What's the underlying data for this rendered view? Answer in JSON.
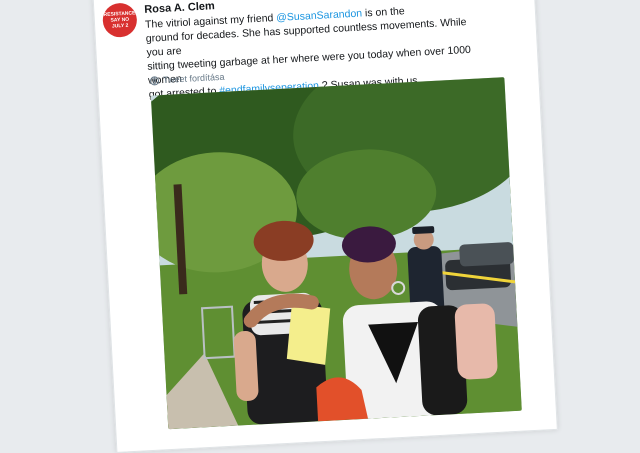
{
  "tweet": {
    "avatar_text": [
      "RESISTANCE",
      "SAY NO",
      "JULY 2"
    ],
    "author": "Rosa A. Clem",
    "text_lead": "The vitriol against my friend ",
    "mention": "@SusanSarandon",
    "text_mid": " is The vitriol against my friend ground for decades. She has supported countless movements. While you are sitting tweeting garbage at her where were you today when over 1000 women got arrested to ",
    "text_lines": [
      "The vitriol against my friend ",
      "ground for decades. She has supported countless movements. While you are",
      "sitting tweeting garbage at her where were you today when over 1000 women",
      "got arrested to "
    ],
    "hashtag": "#endfamilyseperation",
    "text_tail": " ? Susan was with us",
    "mention_suffix": " is on the",
    "translate_label": "Tweet fordítása"
  },
  "photo": {
    "sign_text": "",
    "colors": {
      "sky": "#c9dbe0",
      "foliage_dark": "#2f5a1f",
      "foliage_light": "#6e9b3e",
      "grass": "#5f8f32",
      "path": "#c8bfae",
      "shirt_red": "#e2502a",
      "backpack": "#e7b9aa",
      "paper": "#f4ee8c"
    }
  }
}
